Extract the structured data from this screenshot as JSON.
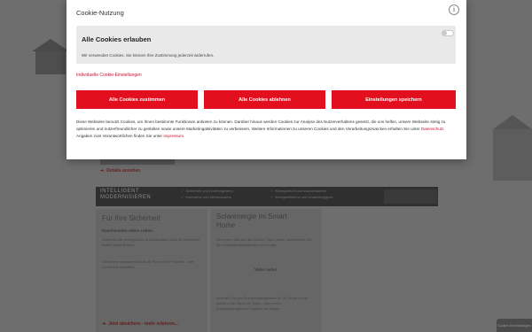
{
  "modal": {
    "title": "Cookie-Nutzung",
    "info_icon": "info-icon",
    "consent": {
      "title": "Alle Cookies erlauben",
      "description": "Wir verwenden Cookies. Sie können Ihre Zustimmung jederzeit widerrufen.",
      "toggle_on": false
    },
    "individual_link": "Individuelle Cookie-Einstellungen",
    "buttons": {
      "accept": "Alle Cookies zustimmen",
      "reject": "Alle Cookies ablehnen",
      "save": "Einstellungen speichern"
    },
    "info": {
      "text1": "Diese Webseite benutzt Cookies, um Ihnen bestimmte Funktionen anbieten zu können. Darüber hinaus werden Cookies zur Analyse des Nutzerverhaltens gesetzt, die uns helfen, unsere Webseite stetig zu optimieren und nutzerfreundlicher zu gestalten sowie unsere Marketingaktivitäten zu verbessern. Weitere Informationen zu unseren Cookies und den Verarbeitungszwecken erhalten Sie unter ",
      "link1": "Datenschutz",
      "text2": ". Angaben zum Verantwortlichen finden Sie unter ",
      "link2": "Impressum",
      "text3": "."
    },
    "accent_color": "#e2101e"
  },
  "background": {
    "details_link": "Details ansehen",
    "smart_title_1": "INTELLIGENT",
    "smart_title_2": "MODERNISIEREN",
    "smart_col1": [
      "Sicherheit und Komfortgewinn",
      "Innovation und Wertzuwachs"
    ],
    "smart_col2": [
      "Klimagerecht und zukunftssicher",
      "Energieeffizienz und Unabhängigkeit"
    ],
    "card1": {
      "title": "Für Ihre Sicherheit",
      "bold": "Rauchmelder retten Leben.",
      "text1": "Jeden Monat verunglücken in Deutschland rund 40 Menschen tödlich durch Brände.",
      "text2": "Wir bieten optimalen Schutz für Sie und Ihre Familie - vom Fachmann installiert.",
      "link": "Jetzt absichern - mehr erfahren..."
    },
    "card2": {
      "title_line1": "Solarenergie im Smart",
      "title_line2": "Home",
      "text1": "Mit einem Klick auf den Button \"Video laden\" akzeptieren Sie die Datenschutzerklärung von Google.",
      "video_button": "Video laden",
      "text2": "Nehmen Sie das Energiemanagement für Ihr Smart Home selbst in die Hand! Mit Solar - dem neuen Energiemanagement System von Hager."
    },
    "cookie_tab": "Cookie-Einstellungen"
  }
}
